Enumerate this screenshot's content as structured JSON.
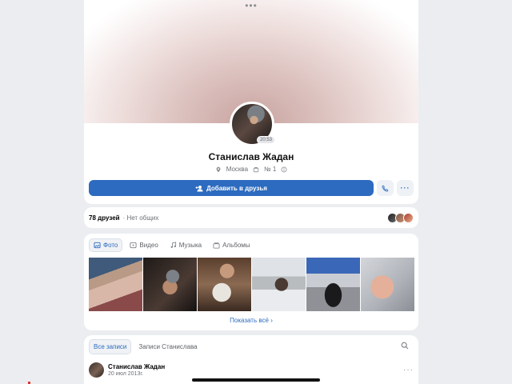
{
  "profile": {
    "name": "Станислав Жадан",
    "avatar_badge": "20:53",
    "location": "Москва",
    "school": "№ 1",
    "add_friend_label": "Добавить в друзья",
    "top_dots": "•••"
  },
  "friends": {
    "count": "78 друзей",
    "mutual": "· Нет общих"
  },
  "media": {
    "tabs": [
      {
        "label": "Фото",
        "icon": "photo-icon",
        "active": true
      },
      {
        "label": "Видео",
        "icon": "video-icon",
        "active": false
      },
      {
        "label": "Музыка",
        "icon": "music-icon",
        "active": false
      },
      {
        "label": "Альбомы",
        "icon": "album-icon",
        "active": false
      }
    ],
    "show_all": "Показать всё ›"
  },
  "posts": {
    "tabs": [
      {
        "label": "Все записи",
        "active": true
      },
      {
        "label": "Записи Станислава",
        "active": false
      }
    ],
    "first_post": {
      "author": "Станислав Жадан",
      "date": "20 июл 2013г."
    }
  },
  "colors": {
    "accent": "#2c6bbf",
    "background": "#ebedf0",
    "card": "#ffffff"
  }
}
